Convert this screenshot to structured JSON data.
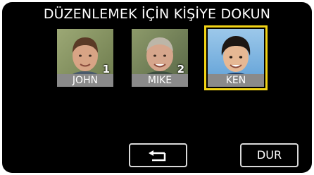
{
  "screen": {
    "title": "DÜZENLEMEK İÇİN KİŞİYE DOKUN"
  },
  "people": [
    {
      "name": "JOHN",
      "number": "1",
      "selected": false
    },
    {
      "name": "MIKE",
      "number": "2",
      "selected": false
    },
    {
      "name": "KEN",
      "number": "",
      "selected": true
    }
  ],
  "buttons": {
    "back_icon": "return-arrow-icon",
    "stop_label": "DUR"
  },
  "colors": {
    "background": "#000000",
    "selection": "#f2d416",
    "name_bar": "#8a8a8a",
    "button_border": "#d9d9d9"
  }
}
